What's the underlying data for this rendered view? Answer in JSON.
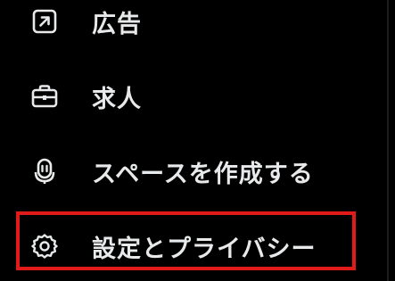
{
  "menu": {
    "items": [
      {
        "id": "ads",
        "label": "広告",
        "icon": "external-link-square-icon"
      },
      {
        "id": "jobs",
        "label": "求人",
        "icon": "briefcase-icon"
      },
      {
        "id": "spaces",
        "label": "スペースを作成する",
        "icon": "microphone-spaces-icon"
      },
      {
        "id": "settings",
        "label": "設定とプライバシー",
        "icon": "gear-icon"
      }
    ]
  },
  "highlight": {
    "target": "settings",
    "color": "#e11a1a"
  },
  "colors": {
    "background": "#000000",
    "text": "#e7e9ea"
  }
}
